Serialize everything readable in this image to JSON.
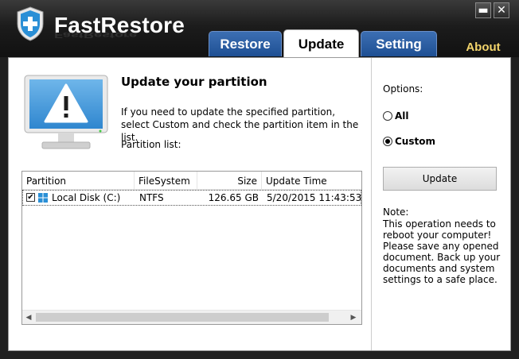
{
  "window": {
    "title": "FastRestore",
    "minimize_glyph": "▬",
    "close_glyph": "✕"
  },
  "tabs": [
    {
      "label": "Restore"
    },
    {
      "label": "Update",
      "active": true
    },
    {
      "label": "Setting"
    },
    {
      "label": "About"
    }
  ],
  "main": {
    "heading": "Update your partition",
    "instruction": "If you need to update the specified partition, select Custom and check the partition item in the list.",
    "partition_label": "Partition list:"
  },
  "list": {
    "columns": [
      "Partition",
      "FileSystem",
      "Size",
      "Update Time"
    ],
    "rows": [
      {
        "checked": true,
        "partition": "Local Disk (C:)",
        "filesystem": "NTFS",
        "size": "126.65 GB",
        "update_time": "5/20/2015 11:43:53"
      }
    ],
    "check_glyph": "✔"
  },
  "options": {
    "label": "Options:",
    "choices": [
      {
        "label": "All",
        "selected": false
      },
      {
        "label": "Custom",
        "selected": true
      }
    ]
  },
  "update_button": {
    "label": "Update"
  },
  "note": {
    "title": "Note:",
    "text": "This operation needs to reboot your computer! Please save any opened document. Back up your documents and system settings to a safe place."
  },
  "colors": {
    "tab_blue": "#2a5ea3",
    "about_gold": "#f3d46b",
    "logo_blue": "#2a8fd6"
  }
}
